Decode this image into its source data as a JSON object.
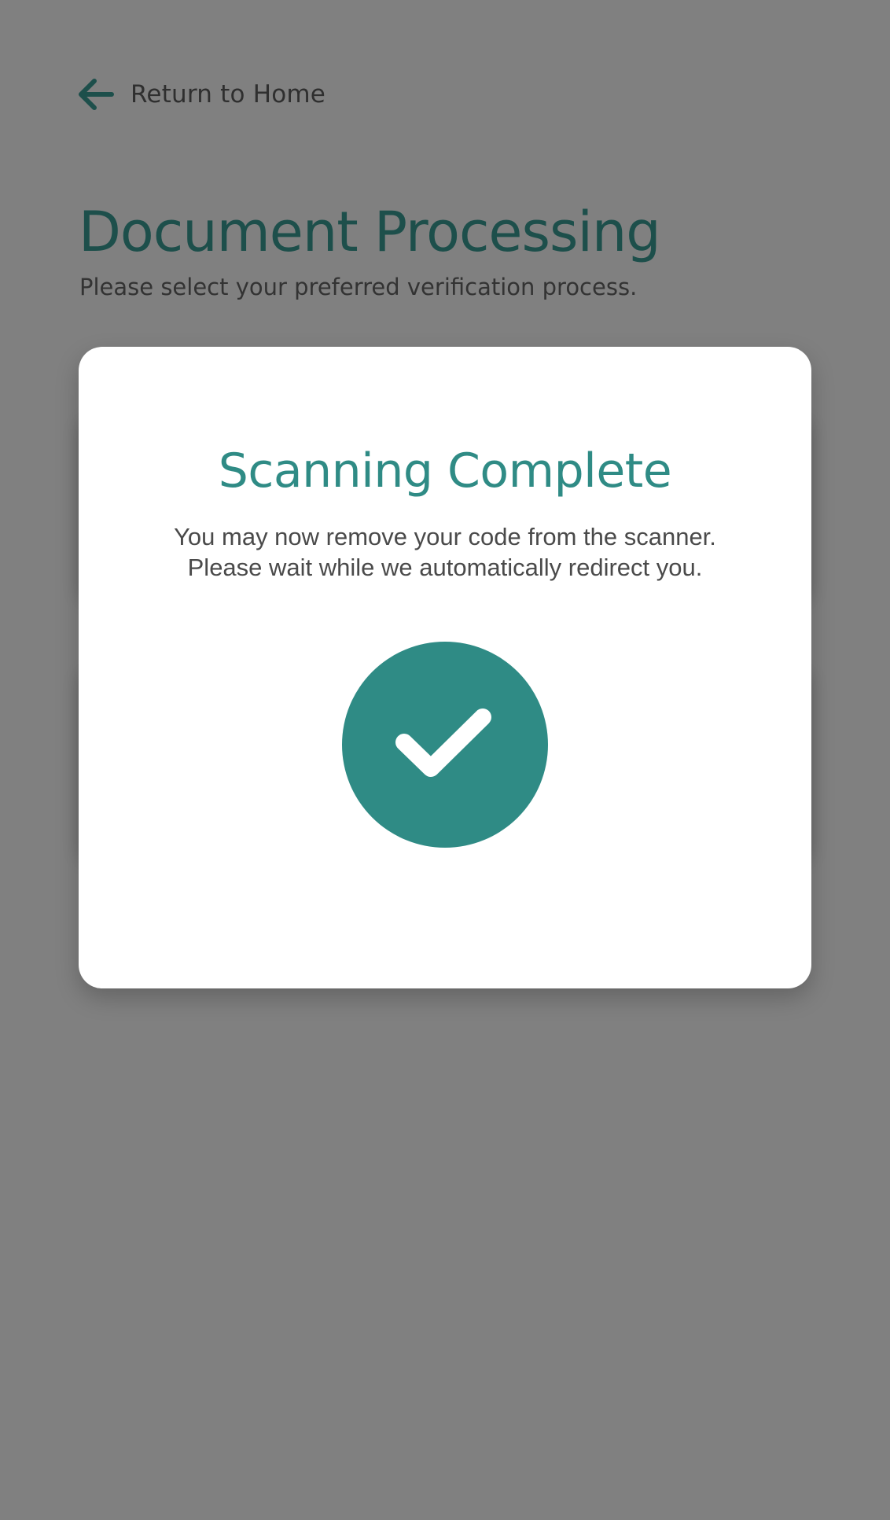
{
  "nav": {
    "back_label": "Return to Home"
  },
  "header": {
    "title": "Document Processing",
    "subtitle": "Please select your preferred verification process."
  },
  "modal": {
    "title": "Scanning Complete",
    "message_line1": "You may now remove your code from the scanner.",
    "message_line2": "Please wait while we automatically redirect you.",
    "status_icon": "check-icon"
  },
  "colors": {
    "overlay_background": "#808080",
    "accent": "#2f8b85",
    "title_dark": "#1d4f4b",
    "modal_background": "#ffffff"
  }
}
